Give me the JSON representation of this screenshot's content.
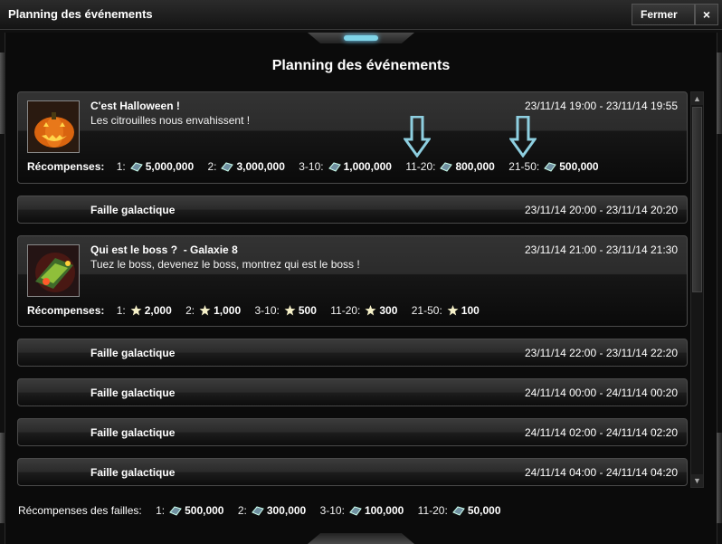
{
  "window": {
    "title": "Planning des événements",
    "close_label": "Fermer",
    "close_x": "×"
  },
  "heading": "Planning des événements",
  "events": [
    {
      "title": "C'est Halloween !",
      "subtitle": "",
      "desc": "Les citrouilles nous envahissent !",
      "time": "23/11/14 19:00 - 23/11/14 19:55",
      "rewards_label": "Récompenses:",
      "reward_icon": "crystal-icon",
      "rewards": [
        {
          "rank": "1:",
          "value": "5,000,000"
        },
        {
          "rank": "2:",
          "value": "3,000,000"
        },
        {
          "rank": "3-10:",
          "value": "1,000,000"
        },
        {
          "rank": "11-20:",
          "value": "800,000"
        },
        {
          "rank": "21-50:",
          "value": "500,000"
        }
      ]
    },
    {
      "title": "Faille galactique",
      "time": "23/11/14 20:00 - 23/11/14 20:20"
    },
    {
      "title": "Qui est le boss ?",
      "subtitle": "-  Galaxie 8",
      "desc": "Tuez le boss, devenez le boss, montrez qui est le boss !",
      "time": "23/11/14 21:00 - 23/11/14 21:30",
      "rewards_label": "Récompenses:",
      "reward_icon": "star-icon",
      "rewards": [
        {
          "rank": "1:",
          "value": "2,000"
        },
        {
          "rank": "2:",
          "value": "1,000"
        },
        {
          "rank": "3-10:",
          "value": "500"
        },
        {
          "rank": "11-20:",
          "value": "300"
        },
        {
          "rank": "21-50:",
          "value": "100"
        }
      ]
    },
    {
      "title": "Faille galactique",
      "time": "23/11/14 22:00 - 23/11/14 22:20"
    },
    {
      "title": "Faille galactique",
      "time": "24/11/14 00:00 - 24/11/14 00:20"
    },
    {
      "title": "Faille galactique",
      "time": "24/11/14 02:00 - 24/11/14 02:20"
    },
    {
      "title": "Faille galactique",
      "time": "24/11/14 04:00 - 24/11/14 04:20"
    }
  ],
  "footer": {
    "label": "Récompenses des failles:",
    "rewards": [
      {
        "rank": "1:",
        "value": "500,000"
      },
      {
        "rank": "2:",
        "value": "300,000"
      },
      {
        "rank": "3-10:",
        "value": "100,000"
      },
      {
        "rank": "11-20:",
        "value": "50,000"
      }
    ]
  },
  "colors": {
    "accent": "#7fd4e8",
    "arrow": "#8ecfe0"
  }
}
